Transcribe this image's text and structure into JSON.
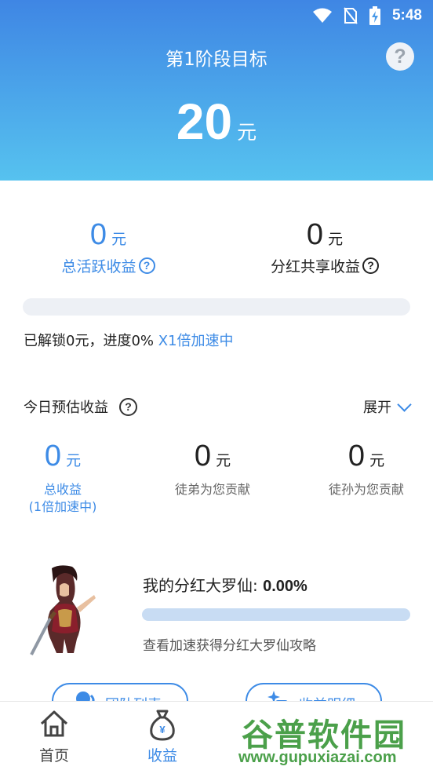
{
  "status_bar": {
    "time": "5:48"
  },
  "header": {
    "title": "第1阶段目标",
    "help_symbol": "?",
    "goal_value": "20",
    "goal_unit": "元"
  },
  "summary": {
    "active_income": {
      "value": "0",
      "unit": "元",
      "label": "总活跃收益"
    },
    "share_income": {
      "value": "0",
      "unit": "元",
      "label": "分红共享收益"
    }
  },
  "progress": {
    "unlock_text": "已解锁0元，进度0%",
    "speed_text": "X1倍加速中",
    "fraction": 0
  },
  "today": {
    "title": "今日预估收益",
    "help_symbol": "?",
    "expand_label": "展开",
    "total": {
      "value": "0",
      "unit": "元",
      "label": "总收益",
      "sublabel": "(1倍加速中)"
    },
    "disciples": {
      "value": "0",
      "unit": "元",
      "label": "徒弟为您贡献"
    },
    "grand": {
      "value": "0",
      "unit": "元",
      "label": "徒孙为您贡献"
    }
  },
  "dividend": {
    "title": "我的分红大罗仙: ",
    "percent": "0.00%",
    "progress_fraction": 0,
    "link": "查看加速获得分红大罗仙攻略"
  },
  "pills": {
    "left_text": "团队列表",
    "right_text": "收益明细"
  },
  "tabbar": {
    "items": [
      {
        "label": "首页",
        "icon": "home-icon"
      },
      {
        "label": "收益",
        "icon": "money-bag-icon"
      }
    ]
  },
  "watermark": {
    "main": "谷普软件园",
    "url": "www.gupuxiazai.com"
  },
  "colors": {
    "accent": "#3d8be6",
    "header_top": "#3f86e4",
    "header_bottom": "#56c2ef"
  }
}
